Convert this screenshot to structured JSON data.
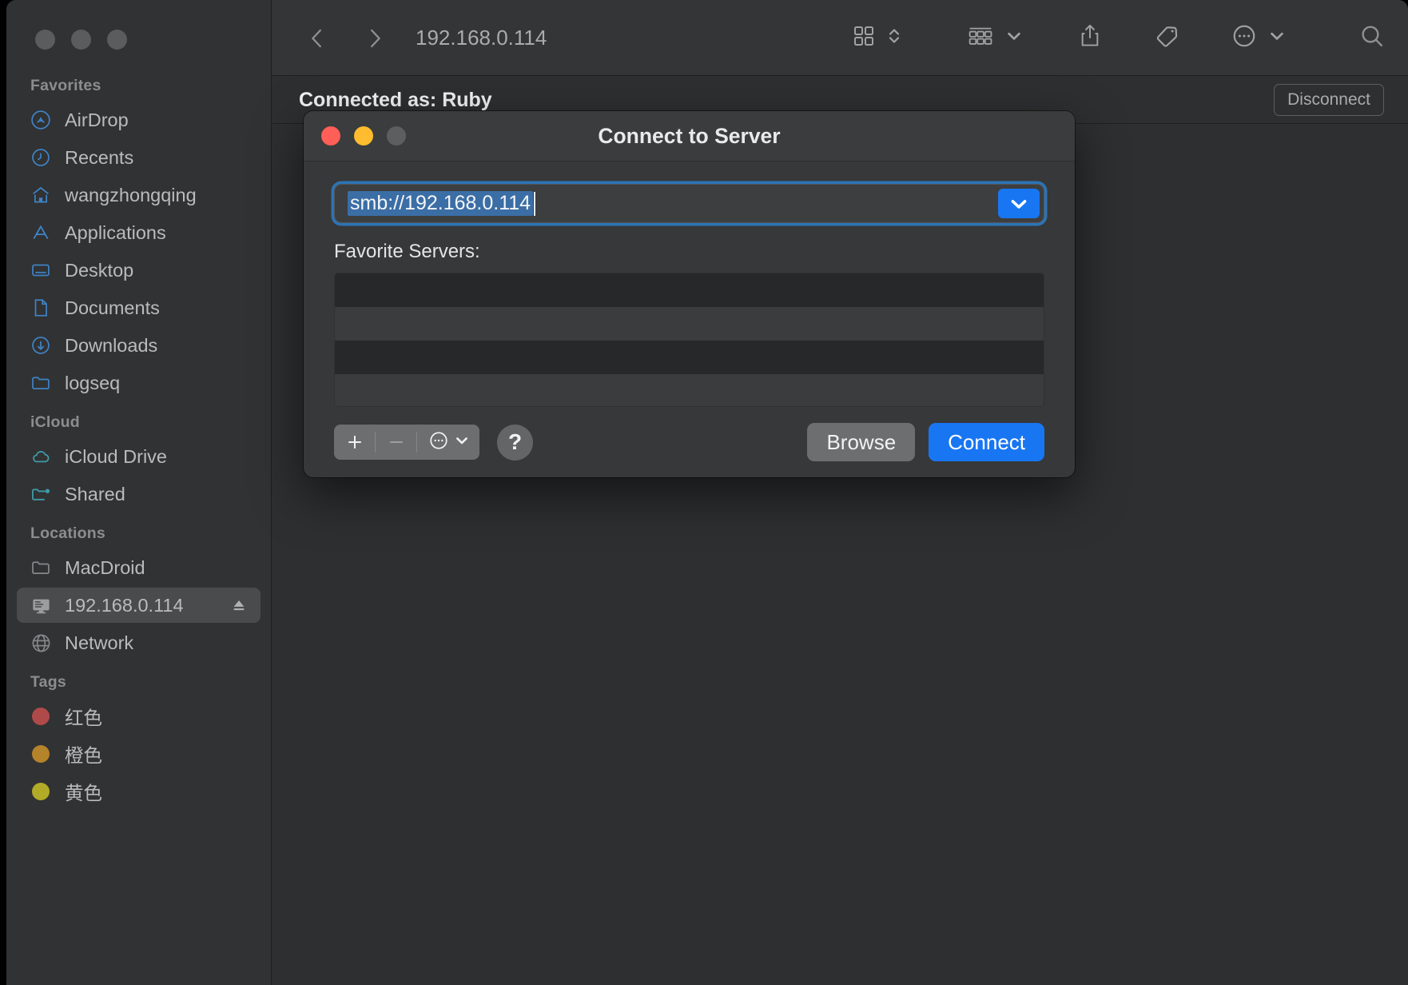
{
  "window": {
    "title": "192.168.0.114",
    "traffic_lights": [
      "close",
      "minimize",
      "zoom"
    ]
  },
  "toolbar": {
    "back_icon": "chevron-left-icon",
    "forward_icon": "chevron-right-icon",
    "path_title": "192.168.0.114",
    "view_icon": "grid-view-icon",
    "view_stepper_icon": "up-down-chevron-icon",
    "group_icon": "group-by-icon",
    "group_chevron_icon": "chevron-down-icon",
    "share_icon": "share-icon",
    "tag_icon": "tag-icon",
    "more_icon": "ellipsis-circle-icon",
    "more_chevron_icon": "chevron-down-icon",
    "search_icon": "search-icon"
  },
  "banner": {
    "connected_as": "Connected as: Ruby",
    "disconnect_label": "Disconnect"
  },
  "sidebar": {
    "sections": [
      {
        "title": "Favorites",
        "items": [
          {
            "label": "AirDrop",
            "icon": "airdrop-icon",
            "selected": false
          },
          {
            "label": "Recents",
            "icon": "clock-icon",
            "selected": false
          },
          {
            "label": "wangzhongqing",
            "icon": "home-icon",
            "selected": false
          },
          {
            "label": "Applications",
            "icon": "applications-icon",
            "selected": false
          },
          {
            "label": "Desktop",
            "icon": "desktop-icon",
            "selected": false
          },
          {
            "label": "Documents",
            "icon": "document-icon",
            "selected": false
          },
          {
            "label": "Downloads",
            "icon": "download-icon",
            "selected": false
          },
          {
            "label": "logseq",
            "icon": "folder-icon",
            "selected": false
          }
        ]
      },
      {
        "title": "iCloud",
        "items": [
          {
            "label": "iCloud Drive",
            "icon": "cloud-icon",
            "selected": false
          },
          {
            "label": "Shared",
            "icon": "shared-folder-icon",
            "selected": false
          }
        ]
      },
      {
        "title": "Locations",
        "items": [
          {
            "label": "MacDroid",
            "icon": "folder-icon",
            "selected": false
          },
          {
            "label": "192.168.0.114",
            "icon": "server-icon",
            "selected": true,
            "eject": true
          },
          {
            "label": "Network",
            "icon": "globe-icon",
            "selected": false
          }
        ]
      },
      {
        "title": "Tags",
        "items": [
          {
            "label": "红色",
            "icon": "tag-dot-icon",
            "color": "#b04a4a",
            "selected": false
          },
          {
            "label": "橙色",
            "icon": "tag-dot-icon",
            "color": "#b5832a",
            "selected": false
          },
          {
            "label": "黄色",
            "icon": "tag-dot-icon",
            "color": "#b2ab28",
            "selected": false
          }
        ]
      }
    ]
  },
  "dialog": {
    "title": "Connect to Server",
    "traffic_lights": [
      "close",
      "minimize",
      "zoom-disabled"
    ],
    "url_value": "smb://192.168.0.114",
    "url_selected": true,
    "url_dropdown_icon": "chevron-down-icon",
    "favorites_label": "Favorite Servers:",
    "favorite_servers": [],
    "favorites_row_count": 4,
    "segmented": {
      "add_icon": "plus-icon",
      "remove_icon": "minus-icon",
      "more_icon": "ellipsis-circle-icon",
      "more_chevron_icon": "chevron-down-icon"
    },
    "help_label": "?",
    "browse_label": "Browse",
    "connect_label": "Connect"
  },
  "colors": {
    "accent_blue": "#1876f2",
    "focus_ring": "#2c73b5",
    "selection_blue": "#3b6ea5",
    "sidebar_icon_blue": "#3f82c4",
    "icloud_icon": "#3f9aa8"
  }
}
